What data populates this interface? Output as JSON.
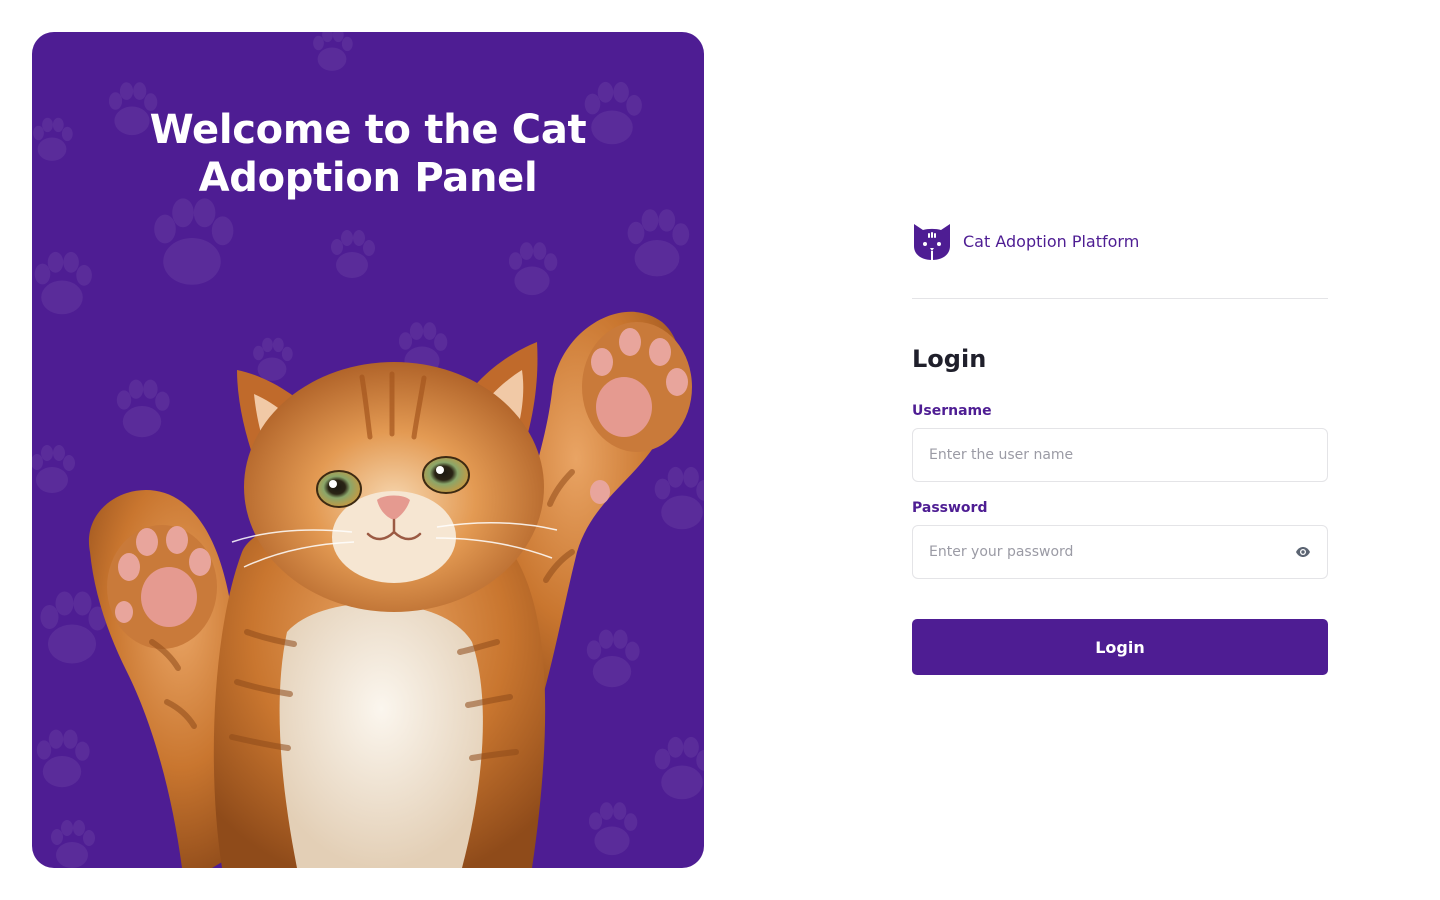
{
  "hero": {
    "title": "Welcome to the Cat Adoption Panel",
    "background_color": "#4e1d93",
    "pattern_icon": "paw-print-icon",
    "image": "raised-paws-kitten-illustration"
  },
  "brand": {
    "name": "Cat Adoption Platform",
    "logo_icon": "cat-face-logo-icon"
  },
  "login_form": {
    "title": "Login",
    "username": {
      "label": "Username",
      "value": "",
      "placeholder": "Enter the user name"
    },
    "password": {
      "label": "Password",
      "value": "",
      "placeholder": "Enter your password",
      "toggle_icon": "eye-icon"
    },
    "submit_label": "Login"
  },
  "colors": {
    "accent": "#4e1d93",
    "text_dark": "#1f1f2b",
    "border": "#e4e4e7",
    "placeholder": "#9b9ba5"
  }
}
